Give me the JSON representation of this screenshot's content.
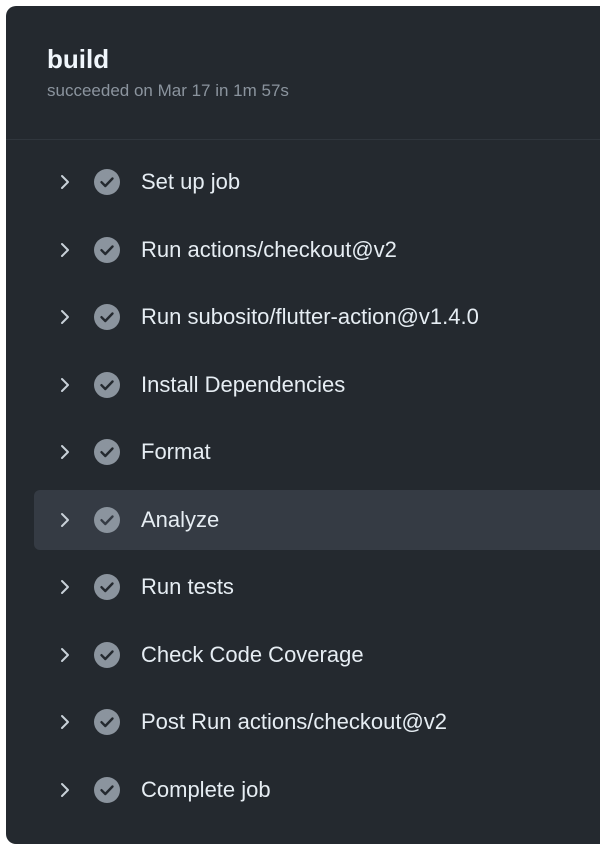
{
  "job": {
    "title": "build",
    "status": "succeeded on Mar 17 in 1m 57s"
  },
  "steps": [
    {
      "label": "Set up job",
      "status": "success",
      "icon": "chevron-right-icon"
    },
    {
      "label": "Run actions/checkout@v2",
      "status": "success",
      "icon": "chevron-right-icon"
    },
    {
      "label": "Run subosito/flutter-action@v1.4.0",
      "status": "success",
      "icon": "chevron-right-icon"
    },
    {
      "label": "Install Dependencies",
      "status": "success",
      "icon": "chevron-right-icon"
    },
    {
      "label": "Format",
      "status": "success",
      "icon": "chevron-right-icon"
    },
    {
      "label": "Analyze",
      "status": "success",
      "icon": "chevron-right-icon",
      "highlighted": true
    },
    {
      "label": "Run tests",
      "status": "success",
      "icon": "chevron-right-icon"
    },
    {
      "label": "Check Code Coverage",
      "status": "success",
      "icon": "chevron-right-icon"
    },
    {
      "label": "Post Run actions/checkout@v2",
      "status": "success",
      "icon": "chevron-right-icon"
    },
    {
      "label": "Complete job",
      "status": "success",
      "icon": "chevron-right-icon"
    }
  ],
  "colors": {
    "panel_background": "#24292f",
    "highlight_background": "#353b44",
    "check_icon": "#8b949e",
    "text": "#e6edf3",
    "muted_text": "#8b949e"
  }
}
